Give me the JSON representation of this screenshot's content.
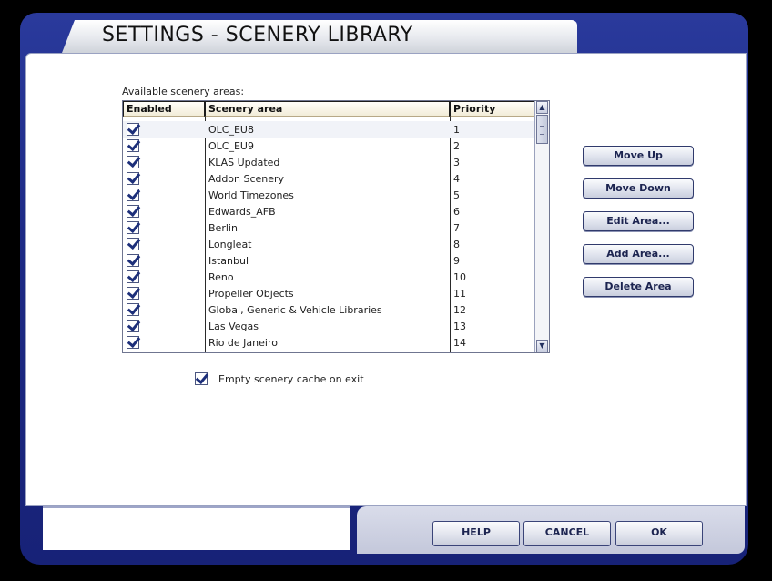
{
  "window": {
    "title": "SETTINGS - SCENERY LIBRARY"
  },
  "list": {
    "label": "Available scenery areas:",
    "columns": {
      "enabled": "Enabled",
      "area": "Scenery area",
      "priority": "Priority"
    },
    "rows": [
      {
        "enabled": true,
        "area": "OLC_EU8",
        "priority": "1"
      },
      {
        "enabled": true,
        "area": "OLC_EU9",
        "priority": "2"
      },
      {
        "enabled": true,
        "area": "KLAS Updated",
        "priority": "3"
      },
      {
        "enabled": true,
        "area": "Addon Scenery",
        "priority": "4"
      },
      {
        "enabled": true,
        "area": "World Timezones",
        "priority": "5"
      },
      {
        "enabled": true,
        "area": "Edwards_AFB",
        "priority": "6"
      },
      {
        "enabled": true,
        "area": "Berlin",
        "priority": "7"
      },
      {
        "enabled": true,
        "area": "Longleat",
        "priority": "8"
      },
      {
        "enabled": true,
        "area": "Istanbul",
        "priority": "9"
      },
      {
        "enabled": true,
        "area": "Reno",
        "priority": "10"
      },
      {
        "enabled": true,
        "area": "Propeller Objects",
        "priority": "11"
      },
      {
        "enabled": true,
        "area": "Global, Generic & Vehicle Libraries",
        "priority": "12"
      },
      {
        "enabled": true,
        "area": "Las Vegas",
        "priority": "13"
      },
      {
        "enabled": true,
        "area": "Rio de Janeiro",
        "priority": "14"
      }
    ]
  },
  "side_buttons": {
    "move_up": "Move Up",
    "move_down": "Move Down",
    "edit_area": "Edit Area...",
    "add_area": "Add Area...",
    "delete_area": "Delete Area"
  },
  "cache": {
    "checked": true,
    "label": "Empty scenery cache on exit"
  },
  "footer": {
    "help": "HELP",
    "cancel": "CANCEL",
    "ok": "OK"
  },
  "colors": {
    "frame": "#1d2a86",
    "accent": "#1d2f7a",
    "header_bg": "#f2ecd8"
  }
}
